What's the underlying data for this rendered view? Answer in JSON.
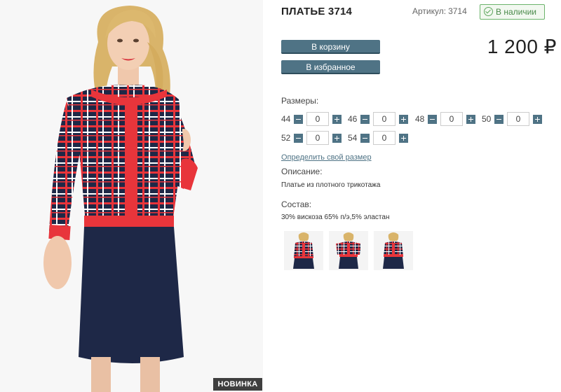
{
  "product": {
    "title": "ПЛАТЬЕ 3714",
    "sku_label": "Артикул:",
    "sku_value": "3714",
    "stock": "В наличии",
    "price": "1 200 ₽",
    "badge": "НОВИНКА"
  },
  "actions": {
    "cart_label": "В корзину",
    "favorite_label": "В избранное"
  },
  "sizes": {
    "label": "Размеры:",
    "items": [
      {
        "size": "44",
        "qty": "0"
      },
      {
        "size": "46",
        "qty": "0"
      },
      {
        "size": "48",
        "qty": "0"
      },
      {
        "size": "50",
        "qty": "0"
      },
      {
        "size": "52",
        "qty": "0"
      },
      {
        "size": "54",
        "qty": "0"
      }
    ],
    "size_link": "Определить свой размер"
  },
  "description": {
    "label": "Описание:",
    "text": "Платье из плотного трикотажа"
  },
  "composition": {
    "label": "Состав:",
    "text": "30% вискоза 65% п/э,5% эластан"
  },
  "colors": {
    "accent": "#4f7385",
    "stock_green": "#5ea65e",
    "dress_red": "#e8353b",
    "dress_navy": "#1e2847"
  }
}
